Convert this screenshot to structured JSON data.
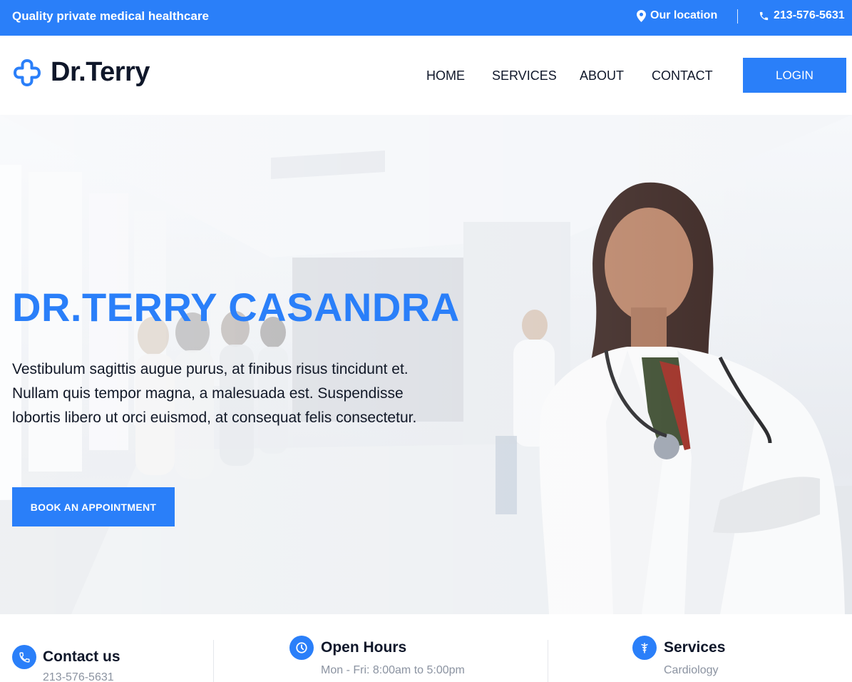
{
  "topbar": {
    "tagline": "Quality private medical healthcare",
    "location_label": "Our location",
    "phone": "213-576-5631"
  },
  "brand": {
    "name": "Dr.Terry"
  },
  "nav": {
    "items": [
      "HOME",
      "SERVICES",
      "ABOUT",
      "CONTACT"
    ],
    "login_label": "LOGIN"
  },
  "hero": {
    "title": "DR.TERRY CASANDRA",
    "description": "Vestibulum sagittis augue purus, at finibus risus tincidunt et. Nullam quis tempor magna, a malesuada est. Suspendisse lobortis libero ut orci euismod, at consequat felis consectetur.",
    "cta_label": "BOOK AN APPOINTMENT"
  },
  "info": {
    "contact": {
      "title": "Contact us",
      "value": "213-576-5631",
      "icon": "phone-icon"
    },
    "hours": {
      "title": "Open Hours",
      "value": "Mon - Fri: 8:00am to 5:00pm",
      "icon": "clock-icon"
    },
    "services": {
      "title": "Services",
      "value": "Cardiology",
      "icon": "caduceus-icon"
    }
  },
  "colors": {
    "accent": "#2a7ff9",
    "dark": "#0f172a",
    "muted": "#8b93a1"
  }
}
